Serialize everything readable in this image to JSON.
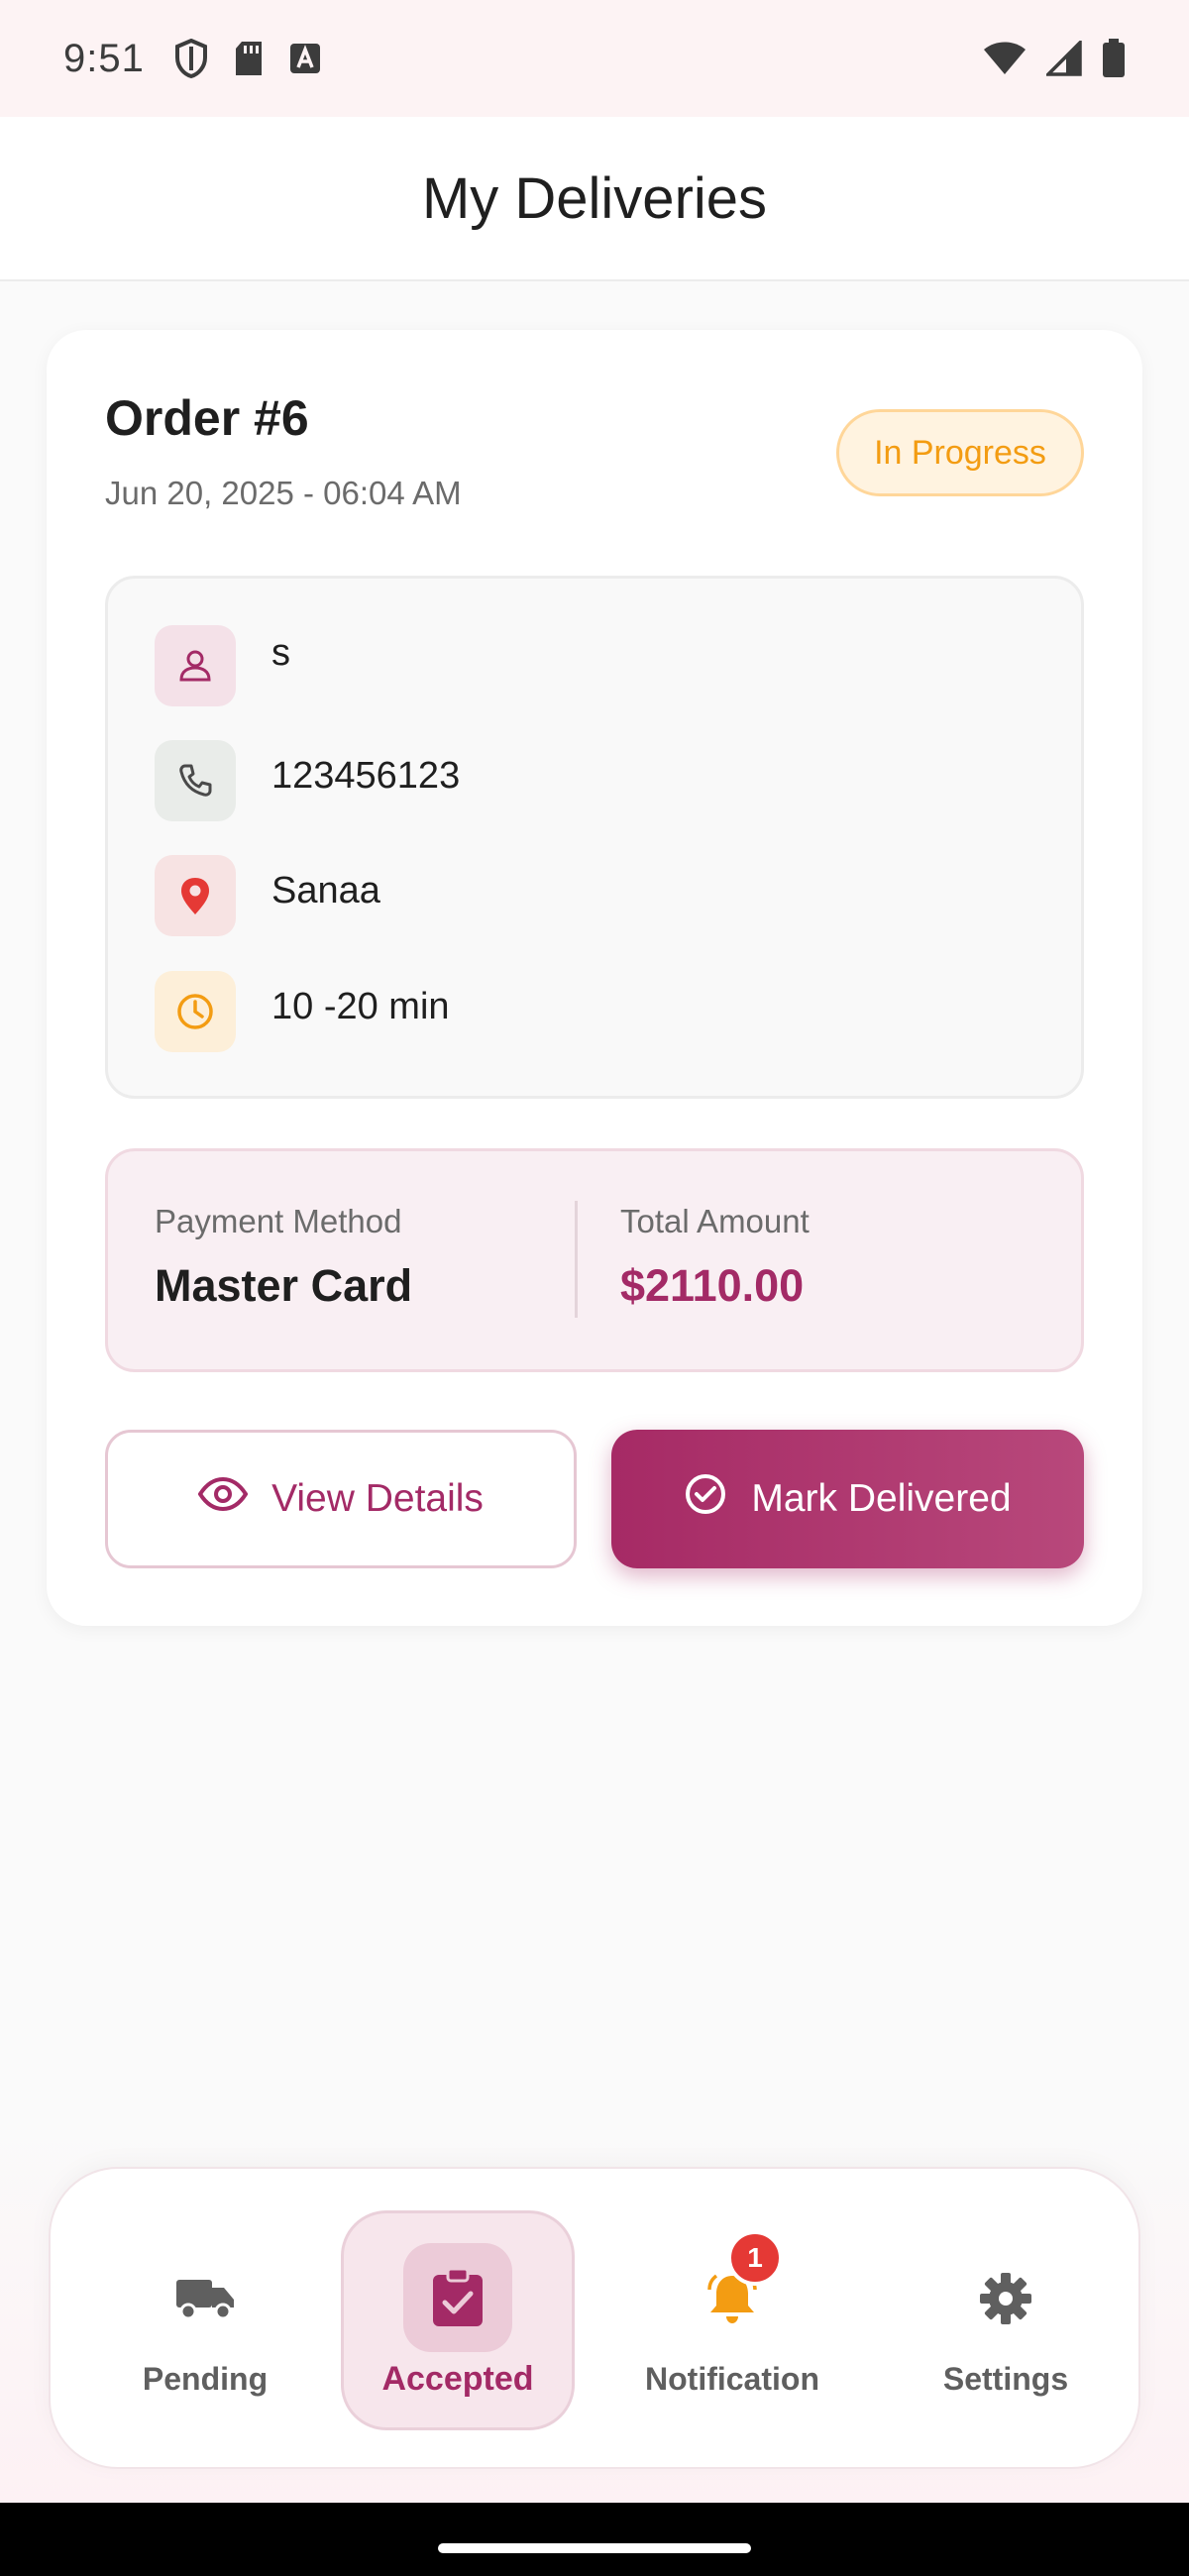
{
  "status_bar": {
    "time": "9:51",
    "left_icons": [
      "shield-icon",
      "sd-card-icon",
      "keyboard-a-icon"
    ],
    "right_icons": [
      "wifi-icon",
      "signal-icon",
      "battery-icon"
    ]
  },
  "header": {
    "title": "My Deliveries"
  },
  "order": {
    "title": "Order #6",
    "date": "Jun 20, 2025 - 06:04 AM",
    "status": "In Progress",
    "customer": {
      "name": "s",
      "phone": "123456123",
      "address": "Sanaa",
      "delivery_time": "10 -20 min"
    },
    "payment": {
      "method_label": "Payment Method",
      "method": "Master Card",
      "total_label": "Total Amount",
      "total": "$2110.00"
    },
    "actions": {
      "view_details": "View Details",
      "mark_delivered": "Mark Delivered"
    }
  },
  "bottom_nav": {
    "items": [
      {
        "label": "Pending",
        "icon": "truck-icon",
        "active": false
      },
      {
        "label": "Accepted",
        "icon": "clipboard-check-icon",
        "active": true
      },
      {
        "label": "Notification",
        "icon": "bell-icon",
        "active": false,
        "badge": "1"
      },
      {
        "label": "Settings",
        "icon": "gear-icon",
        "active": false
      }
    ]
  },
  "colors": {
    "primary": "#a32a66",
    "status_in_progress": "#f39c12",
    "notification_badge": "#e53935",
    "status_bar_bg": "#fdf3f4"
  }
}
